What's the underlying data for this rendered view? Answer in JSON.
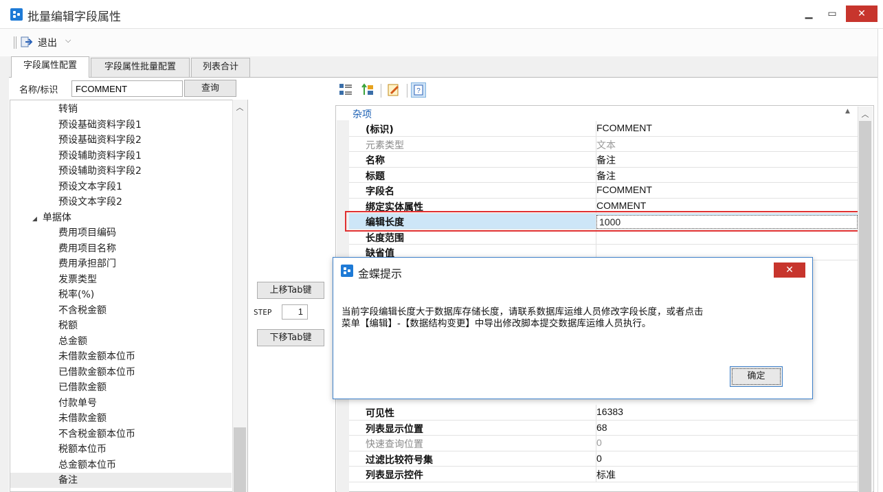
{
  "window": {
    "title": "批量编辑字段属性"
  },
  "toolbar": {
    "exit_label": "退出"
  },
  "tabs": [
    {
      "label": "字段属性配置",
      "active": true
    },
    {
      "label": "字段属性批量配置",
      "active": false
    },
    {
      "label": "列表合计",
      "active": false
    }
  ],
  "search": {
    "label": "名称/标识",
    "value": "FCOMMENT",
    "button": "查询"
  },
  "tree": {
    "items": [
      {
        "label": "转销",
        "level": 2
      },
      {
        "label": "预设基础资料字段1",
        "level": 2
      },
      {
        "label": "预设基础资料字段2",
        "level": 2
      },
      {
        "label": "预设辅助资料字段1",
        "level": 2
      },
      {
        "label": "预设辅助资料字段2",
        "level": 2
      },
      {
        "label": "预设文本字段1",
        "level": 2
      },
      {
        "label": "预设文本字段2",
        "level": 2
      },
      {
        "label": "单据体",
        "level": 1,
        "expanded": true
      },
      {
        "label": "费用项目编码",
        "level": 2
      },
      {
        "label": "费用项目名称",
        "level": 2
      },
      {
        "label": "费用承担部门",
        "level": 2
      },
      {
        "label": "发票类型",
        "level": 2
      },
      {
        "label": "税率(%)",
        "level": 2
      },
      {
        "label": "不含税金额",
        "level": 2
      },
      {
        "label": "税额",
        "level": 2
      },
      {
        "label": "总金额",
        "level": 2
      },
      {
        "label": "未借款金额本位币",
        "level": 2
      },
      {
        "label": "已借款金额本位币",
        "level": 2
      },
      {
        "label": "已借款金额",
        "level": 2
      },
      {
        "label": "付款单号",
        "level": 2
      },
      {
        "label": "未借款金额",
        "level": 2
      },
      {
        "label": "不含税金额本位币",
        "level": 2
      },
      {
        "label": "税额本位币",
        "level": 2
      },
      {
        "label": "总金额本位币",
        "level": 2
      },
      {
        "label": "备注",
        "level": 2,
        "selected": true
      }
    ]
  },
  "middle": {
    "move_up": "上移Tab键",
    "step_label": "STEP",
    "step_value": "1",
    "move_down": "下移Tab键"
  },
  "propgrid": {
    "category": "杂项",
    "rows_top": [
      {
        "name": "(标识)",
        "value": "FCOMMENT",
        "dim": false
      },
      {
        "name": "元素类型",
        "value": "文本",
        "dim": true
      },
      {
        "name": "名称",
        "value": "备注",
        "dim": false
      },
      {
        "name": "标题",
        "value": "备注",
        "dim": false
      },
      {
        "name": "字段名",
        "value": "FCOMMENT",
        "dim": false
      },
      {
        "name": "绑定实体属性",
        "value": "COMMENT",
        "dim": false
      },
      {
        "name": "编辑长度",
        "value": "1000",
        "dim": false,
        "selected": true
      },
      {
        "name": "长度范围",
        "value": "",
        "dim": false
      },
      {
        "name": "缺省值",
        "value": "",
        "dim": false
      }
    ],
    "rows_bottom": [
      {
        "name": "可见性",
        "value": "16383",
        "dim": false
      },
      {
        "name": "列表显示位置",
        "value": "68",
        "dim": false
      },
      {
        "name": "快速查询位置",
        "value": "0",
        "dim": true
      },
      {
        "name": "过滤比较符号集",
        "value": "0",
        "dim": false
      },
      {
        "name": "列表显示控件",
        "value": "标准",
        "dim": false
      }
    ]
  },
  "dialog": {
    "title": "金蝶提示",
    "message_line1": "当前字段编辑长度大于数据库存储长度，请联系数据库运维人员修改字段长度，或者点击",
    "message_line2": "菜单【编辑】-【数据结构变更】中导出修改脚本提交数据库运维人员执行。",
    "ok": "确定"
  },
  "colors": {
    "accent": "#1e7ad6",
    "close": "#c7352d",
    "highlight": "#e03030",
    "selection": "#cde6f7"
  }
}
